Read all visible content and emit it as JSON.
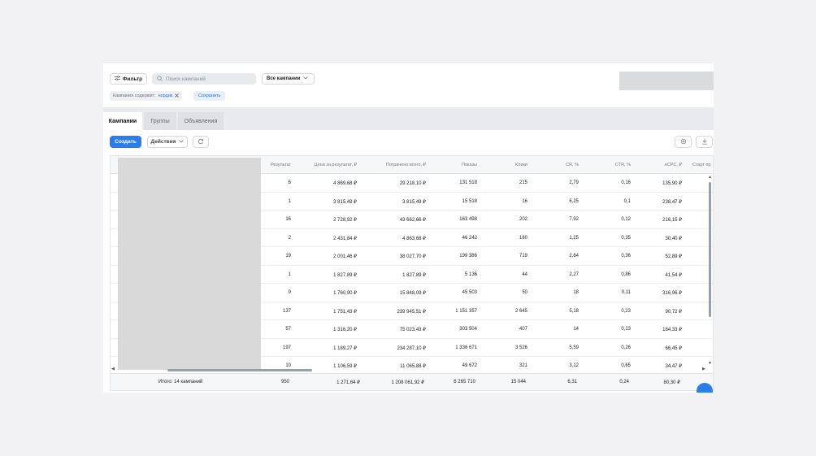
{
  "topbar": {
    "filter_label": "Фильтр",
    "search_placeholder": "Поиск кампаний",
    "campaign_select": "Все кампании",
    "chip_prefix": "Кампания содержит:",
    "chip_value": "нордик",
    "save_label": "Сохранить"
  },
  "tabs": [
    {
      "label": "Кампании",
      "active": true
    },
    {
      "label": "Группы",
      "active": false
    },
    {
      "label": "Объявления",
      "active": false
    }
  ],
  "toolbar": {
    "create_label": "Создать",
    "actions_label": "Действия"
  },
  "table": {
    "headers": [
      "Результат",
      "Цена за результат, ₽",
      "Потрачено всего, ₽",
      "Показы",
      "Клики",
      "CR, %",
      "CTR, %",
      "eCPC, ₽",
      "Старт пр"
    ],
    "rows": [
      [
        "6",
        "4 869,68 ₽",
        "29 218,10 ₽",
        "131 518",
        "215",
        "2,79",
        "0,16",
        "135,90 ₽"
      ],
      [
        "1",
        "3 815,49 ₽",
        "3 815,49 ₽",
        "15 518",
        "16",
        "6,25",
        "0,1",
        "238,47 ₽"
      ],
      [
        "16",
        "2 728,92 ₽",
        "43 662,66 ₽",
        "163 498",
        "202",
        "7,92",
        "0,12",
        "216,15 ₽"
      ],
      [
        "2",
        "2 431,84 ₽",
        "4 863,68 ₽",
        "46 242",
        "160",
        "1,25",
        "0,35",
        "30,40 ₽"
      ],
      [
        "19",
        "2 001,46 ₽",
        "38 027,70 ₽",
        "199 386",
        "719",
        "2,64",
        "0,36",
        "52,89 ₽"
      ],
      [
        "1",
        "1 827,89 ₽",
        "1 827,89 ₽",
        "5 136",
        "44",
        "2,27",
        "0,86",
        "41,54 ₽"
      ],
      [
        "9",
        "1 760,90 ₽",
        "15 848,09 ₽",
        "45 503",
        "50",
        "18",
        "0,11",
        "316,96 ₽"
      ],
      [
        "137",
        "1 751,43 ₽",
        "239 945,51 ₽",
        "1 151 357",
        "2 645",
        "5,18",
        "0,23",
        "90,72 ₽"
      ],
      [
        "57",
        "1 316,20 ₽",
        "75 023,43 ₽",
        "303 504",
        "407",
        "14",
        "0,13",
        "184,33 ₽"
      ],
      [
        "197",
        "1 189,27 ₽",
        "234 287,10 ₽",
        "1 336 671",
        "3 526",
        "5,59",
        "0,26",
        "66,45 ₽"
      ],
      [
        "10",
        "1 106,59 ₽",
        "11 065,88 ₽",
        "49 672",
        "321",
        "3,12",
        "0,65",
        "34,47 ₽"
      ]
    ],
    "total": [
      "Итого: 14 кампаний",
      "950",
      "1 271,64 ₽",
      "1 208 061,92 ₽",
      "6 265 710",
      "15 044",
      "6,31",
      "0,24",
      "80,30 ₽"
    ]
  },
  "icons": {
    "filter": "sliders-icon",
    "search": "search-icon",
    "chevron": "chevron-down-icon",
    "close": "close-icon",
    "refresh": "refresh-icon",
    "settings": "gear-icon",
    "download": "download-icon",
    "chat": "chat-icon"
  },
  "colors": {
    "accent": "#2b7de9",
    "link": "#2a6fd6"
  }
}
